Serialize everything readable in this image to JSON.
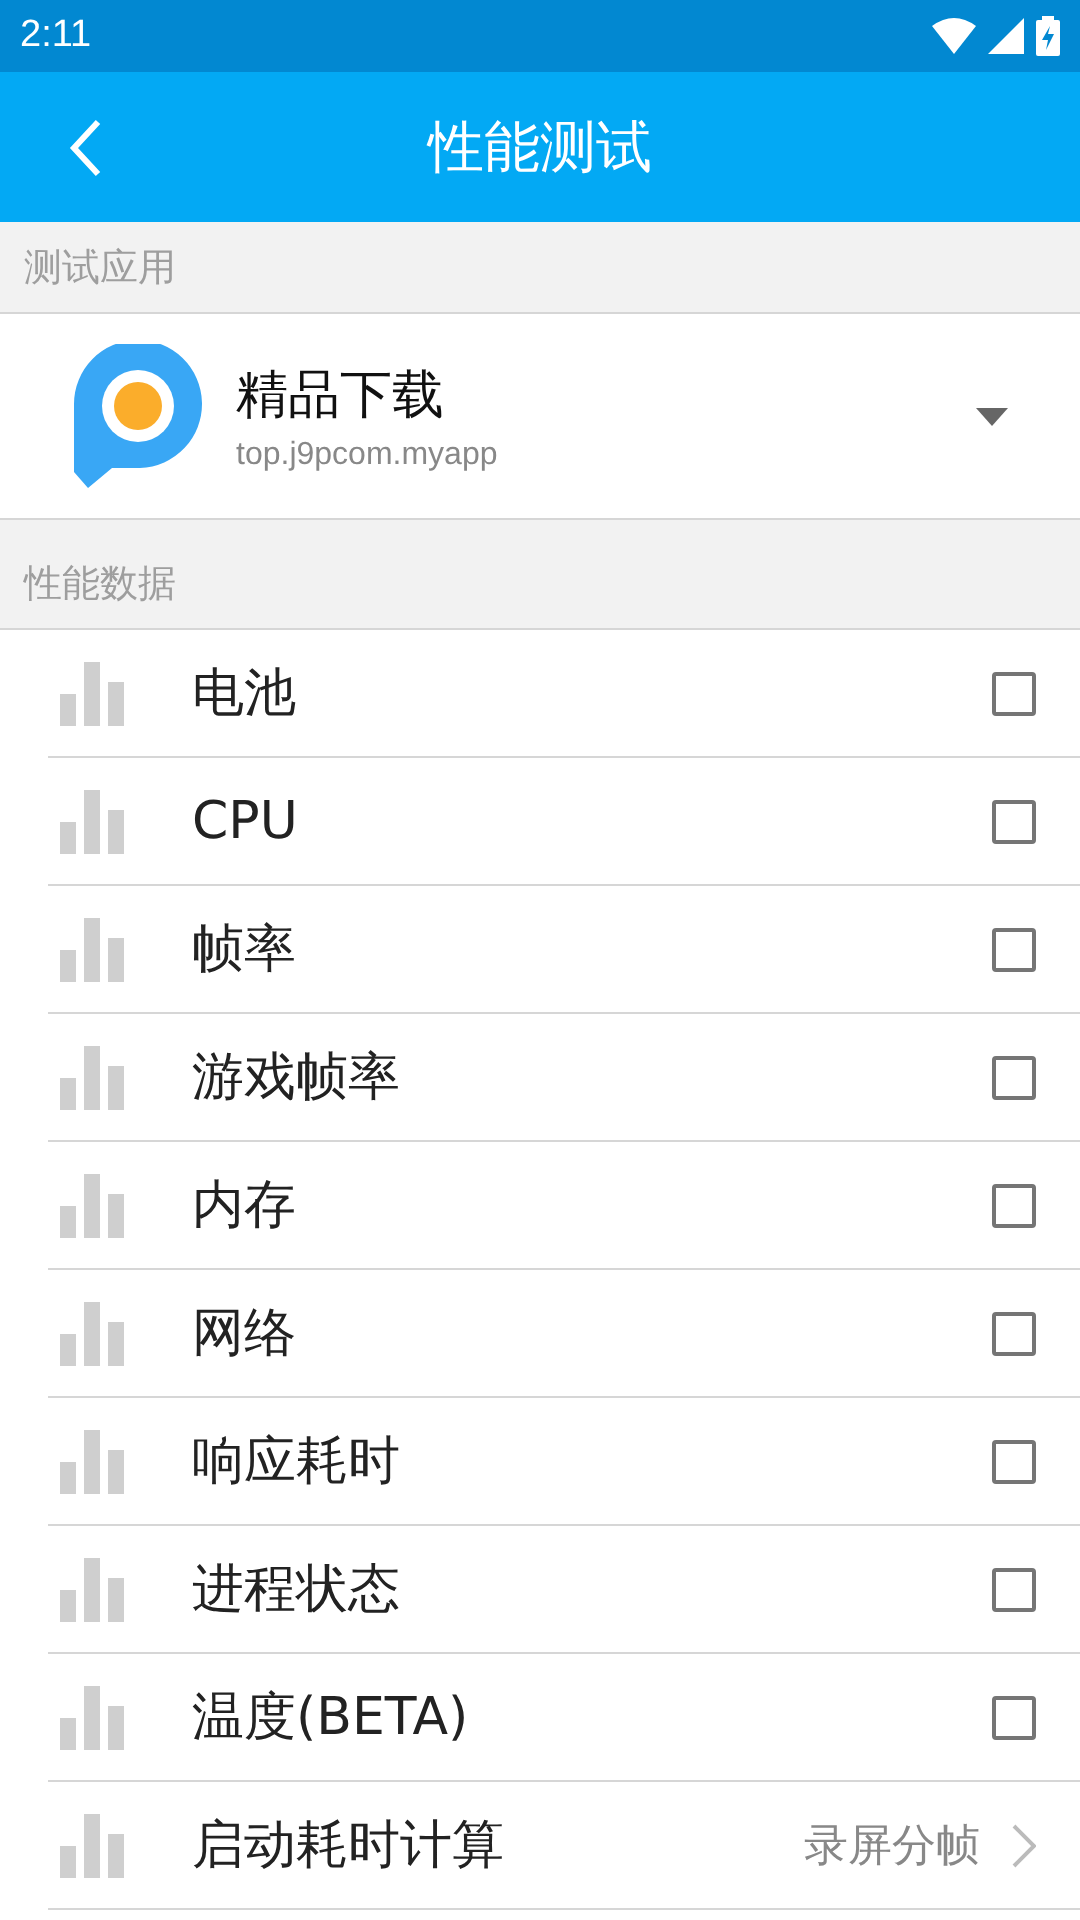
{
  "status_bar": {
    "time": "2:11"
  },
  "app_bar": {
    "title": "性能测试"
  },
  "app_section": {
    "header": "测试应用",
    "app": {
      "name": "精品下载",
      "package": "top.j9pcom.myapp"
    }
  },
  "metrics_section": {
    "header": "性能数据",
    "items": [
      {
        "kind": "checkbox",
        "label": "电池",
        "checked": false
      },
      {
        "kind": "checkbox",
        "label": "CPU",
        "checked": false
      },
      {
        "kind": "checkbox",
        "label": "帧率",
        "checked": false
      },
      {
        "kind": "checkbox",
        "label": "游戏帧率",
        "checked": false
      },
      {
        "kind": "checkbox",
        "label": "内存",
        "checked": false
      },
      {
        "kind": "checkbox",
        "label": "网络",
        "checked": false
      },
      {
        "kind": "checkbox",
        "label": "响应耗时",
        "checked": false
      },
      {
        "kind": "checkbox",
        "label": "进程状态",
        "checked": false
      },
      {
        "kind": "checkbox",
        "label": "温度(BETA)",
        "checked": false
      },
      {
        "kind": "link",
        "label": "启动耗时计算",
        "value": "录屏分帧"
      }
    ]
  }
}
